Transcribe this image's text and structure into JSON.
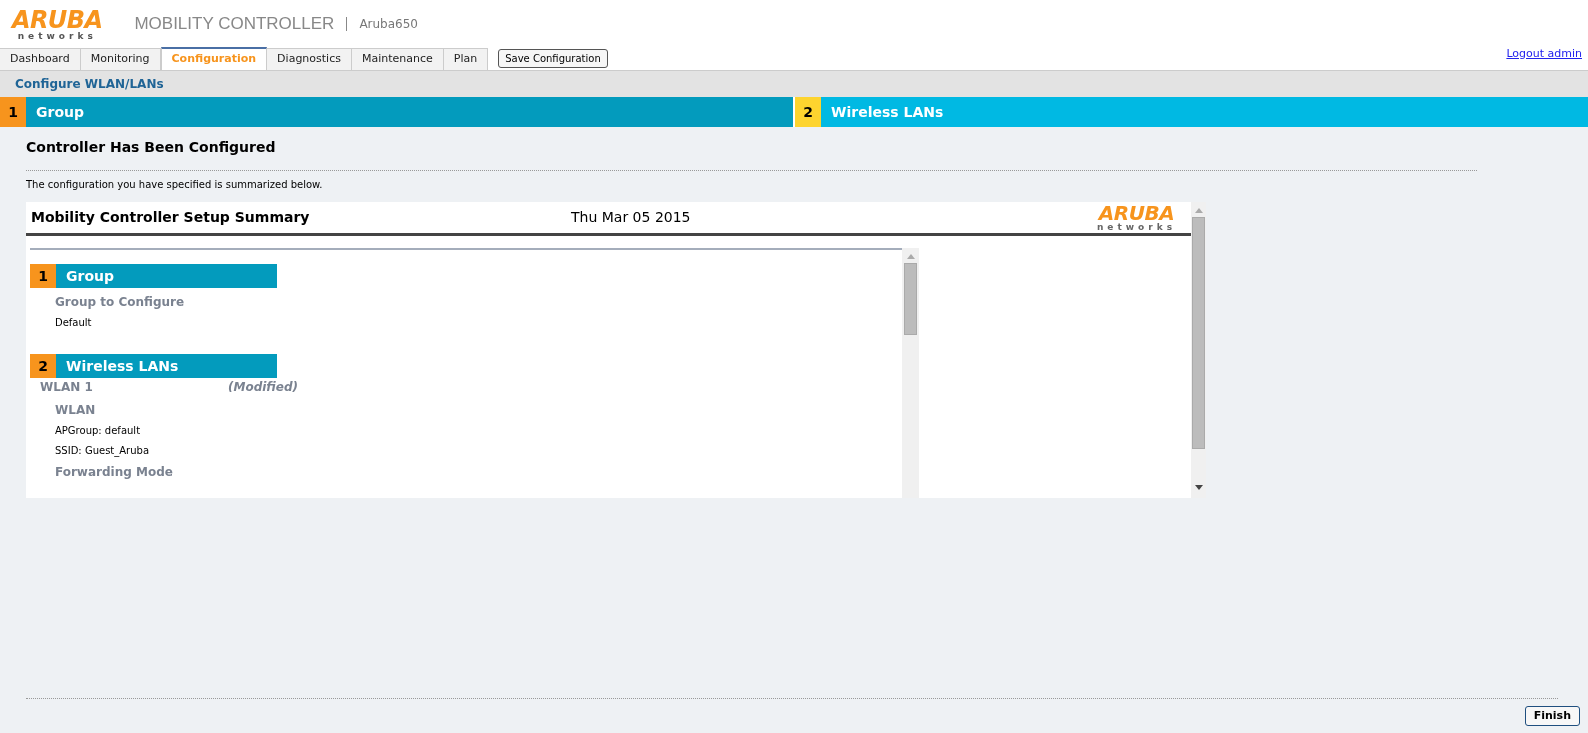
{
  "header": {
    "logo": {
      "word": "ARUBA",
      "tagline": "networks"
    },
    "product": "MOBILITY CONTROLLER",
    "device": "Aruba650"
  },
  "tabs": [
    {
      "label": "Dashboard",
      "selected": false
    },
    {
      "label": "Monitoring",
      "selected": false
    },
    {
      "label": "Configuration",
      "selected": true
    },
    {
      "label": "Diagnostics",
      "selected": false
    },
    {
      "label": "Maintenance",
      "selected": false
    },
    {
      "label": "Plan",
      "selected": false
    }
  ],
  "save_button": "Save Configuration",
  "logout_link": "Logout admin",
  "breadcrumb": "Configure WLAN/LANs",
  "steps": [
    {
      "number": "1",
      "label": "Group",
      "kind": "done"
    },
    {
      "number": "2",
      "label": "Wireless LANs",
      "kind": "current"
    }
  ],
  "heading": "Controller Has Been Configured",
  "description": "The configuration you have specified is summarized below.",
  "summary": {
    "title": "Mobility Controller Setup Summary",
    "date": "Thu Mar 05 2015",
    "logo": {
      "word": "ARUBA",
      "tagline": "networks"
    },
    "sections": [
      {
        "number": "1",
        "title": "Group",
        "items": [
          {
            "kind": "label",
            "text": "Group to Configure"
          },
          {
            "kind": "value",
            "text": "Default"
          }
        ]
      },
      {
        "number": "2",
        "title": "Wireless LANs",
        "items": [
          {
            "kind": "wlan",
            "text": "WLAN 1",
            "status": "(Modified)"
          },
          {
            "kind": "label",
            "text": "WLAN"
          },
          {
            "kind": "value",
            "text": "APGroup: default"
          },
          {
            "kind": "value",
            "text": "SSID: Guest_Aruba"
          },
          {
            "kind": "label",
            "text": "Forwarding Mode"
          }
        ]
      }
    ]
  },
  "finish_button": "Finish"
}
